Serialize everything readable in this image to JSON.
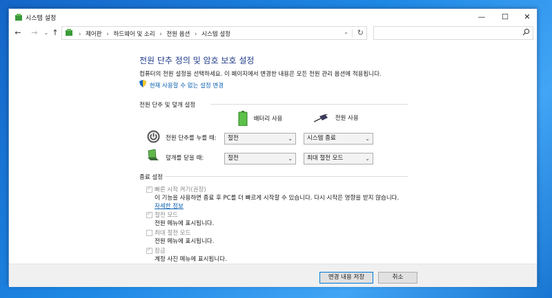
{
  "window": {
    "title": "시스템 설정"
  },
  "nav": {
    "crumbs": [
      "제어판",
      "하드웨어 및 소리",
      "전원 옵션",
      "시스템 설정"
    ],
    "search_placeholder": ""
  },
  "page": {
    "heading": "전원 단추 정의 및 암호 보호 설정",
    "description": "컴퓨터의 전원 설정을 선택하세요. 이 페이지에서 변경한 내용은 모든 전원 관리 옵션에 적용됩니다.",
    "change_link": "현재 사용할 수 없는 설정 변경"
  },
  "power_section": {
    "title": "전원 단추 및 덮개 설정",
    "col_battery": "배터리 사용",
    "col_plugged": "전원 사용",
    "rows": [
      {
        "label": "전원 단추를 누를 때:",
        "battery": "절전",
        "plugged": "시스템 종료"
      },
      {
        "label": "덮개를 닫을 때:",
        "battery": "절전",
        "plugged": "최대 절전 모드"
      }
    ]
  },
  "shutdown_section": {
    "title": "종료 설정",
    "items": [
      {
        "label": "빠른 시작 켜기(권장)",
        "checked": true,
        "desc": "이 기능을 사용하면 종료 후 PC를 더 빠르게 시작할 수 있습니다. 다시 시작은 영향을 받지 않습니다.",
        "link": "자세한 정보"
      },
      {
        "label": "절전 모드",
        "checked": true,
        "desc": "전원 메뉴에 표시됩니다."
      },
      {
        "label": "최대 절전 모드",
        "checked": false,
        "desc": "전원 메뉴에 표시됩니다."
      },
      {
        "label": "잠금",
        "checked": true,
        "desc": "계정 사진 메뉴에 표시됩니다."
      }
    ]
  },
  "footer": {
    "save": "변경 내용 저장",
    "cancel": "취소"
  }
}
